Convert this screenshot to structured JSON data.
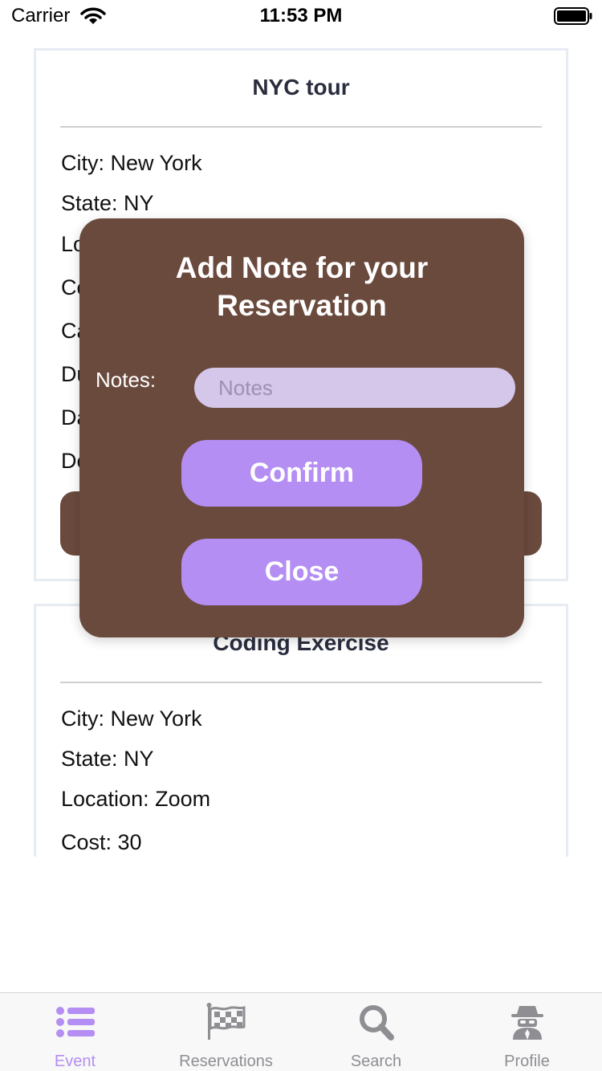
{
  "status_bar": {
    "carrier": "Carrier",
    "time": "11:53 PM"
  },
  "cards": [
    {
      "title": "NYC tour",
      "lines": [
        "City: New York",
        "State: NY",
        "Lo",
        "Co",
        "Ca",
        "Du",
        "Da",
        "De"
      ]
    },
    {
      "title": "Coding Exercise",
      "lines": [
        "City: New York",
        "State: NY",
        "Location: Zoom",
        "Cost: 30"
      ]
    }
  ],
  "modal": {
    "title": "Add Note for your Reservation",
    "notes_label": "Notes:",
    "notes_value": "",
    "notes_placeholder": "Notes",
    "confirm_label": "Confirm",
    "close_label": "Close"
  },
  "tab_bar": {
    "tabs": [
      {
        "label": "Event",
        "icon": "list-icon",
        "active": true
      },
      {
        "label": "Reservations",
        "icon": "flag-icon",
        "active": false
      },
      {
        "label": "Search",
        "icon": "search-icon",
        "active": false
      },
      {
        "label": "Profile",
        "icon": "spy-icon",
        "active": false
      }
    ]
  },
  "colors": {
    "accent": "#b48ef2",
    "modal_background": "#6b4a3e",
    "input_background": "#d4c7ea",
    "inactive_tab": "#8e8e93"
  }
}
